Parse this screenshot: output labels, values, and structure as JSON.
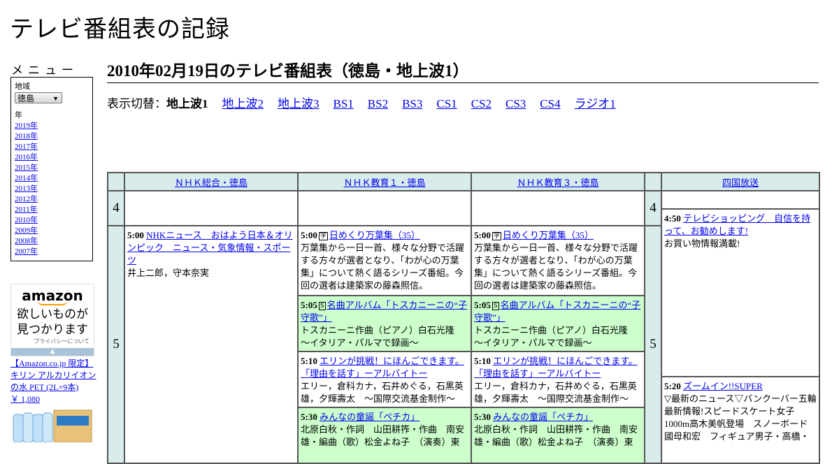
{
  "site": {
    "title": "テレビ番組表の記録"
  },
  "sidebar": {
    "menu_label": "メニュー",
    "region_label": "地域",
    "region_value": "徳島",
    "year_label": "年",
    "years": [
      "2019年",
      "2018年",
      "2017年",
      "2016年",
      "2015年",
      "2014年",
      "2013年",
      "2012年",
      "2011年",
      "2010年",
      "2009年",
      "2008年",
      "2007年"
    ],
    "ad": {
      "logo": "amazon",
      "text": "欲しいものが見つかります",
      "privacy": "プライバシーについて",
      "bar": "▲"
    },
    "product": {
      "name": "【Amazon.co.jp 限定】キリン アルカリイオンの水 PET (2L×9本)",
      "price": "￥ 1,080"
    }
  },
  "main": {
    "heading": "2010年02月19日のテレビ番組表（徳島・地上波1）",
    "switch_label": "表示切替：",
    "current": "地上波1",
    "links": [
      "地上波2",
      "地上波3",
      "BS1",
      "BS2",
      "BS3",
      "CS1",
      "CS2",
      "CS3",
      "CS4",
      "ラジオ1"
    ]
  },
  "schedule": {
    "channels": [
      "ＮＨＫ総合・徳島",
      "ＮＨＫ教育１・徳島",
      "ＮＨＫ教育３・徳島",
      "四国放送"
    ],
    "hours": [
      "4",
      "5"
    ],
    "nhk_sogo": {
      "p1": {
        "time": "5:00",
        "title": "NHKニュース　おはよう日本＆オリンピック　ニュース・気象情報・スポーツ",
        "desc": "井上二郎，守本奈実"
      }
    },
    "edu": [
      {
        "time": "5:00",
        "mark": "字",
        "title": "日めくり万葉集（35）",
        "desc": "万葉集から一日一首、様々な分野で活躍する方々が選者となり、「わが心の万葉集」について熱く語るシリーズ番組。今回の選者は建築家の藤森照信。"
      },
      {
        "time": "5:05",
        "mark": "S",
        "title": "名曲アルバム「トスカニーニの“子守歌”」",
        "desc": "トスカニーニ作曲（ピアノ）白石光隆　～イタリア・パルマで録画～"
      },
      {
        "time": "5:10",
        "title": "エリンが挑戦！にほんごできます。「理由を話す」ーアルバイトー",
        "desc": "エリー，倉科カナ，石井めぐる，石黒英雄，夕輝壽太　～国際交流基金制作～"
      },
      {
        "time": "5:30",
        "title": "みんなの童謡「ペチカ」",
        "desc": "北原白秋・作詞　山田耕筰・作曲　南安雄・編曲（歌）松金よね子　（演奏）東"
      }
    ],
    "shikoku": [
      {
        "time": "4:50",
        "title": "テレビショッピング　自信を持って、お勧めします!",
        "desc": "お買い物情報満載!"
      },
      {
        "time": "5:20",
        "title": "ズームイン!!SUPER",
        "desc": "▽最新のニュース▽バンクーバー五輪最新情報!スピードスケート女子1000m高木美帆登場　スノーボード國母和宏　フィギュア男子・高橋・"
      }
    ]
  }
}
